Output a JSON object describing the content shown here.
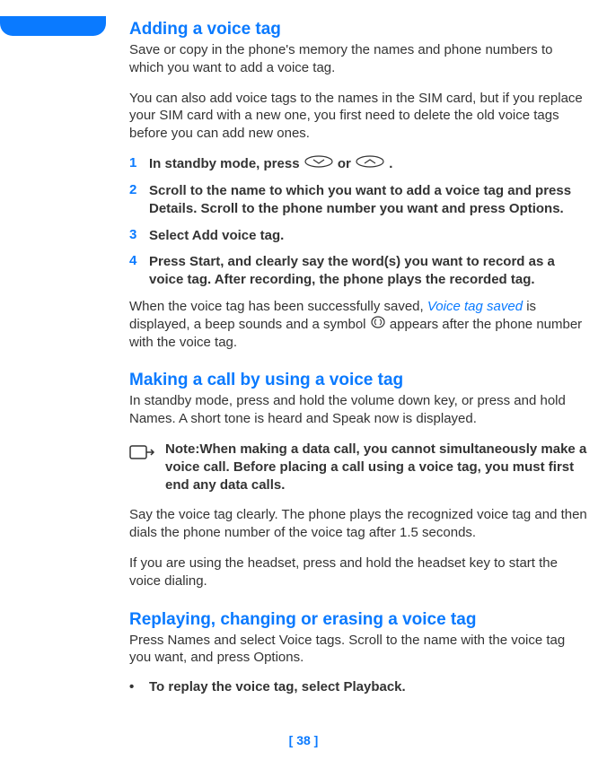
{
  "section1": {
    "title": "Adding a voice tag",
    "p1": "Save or copy in the phone's memory the names and phone numbers to which you want to add a voice tag.",
    "p2": "You can also add voice tags to the names in the SIM card, but if you replace your SIM card with a new one, you first need to delete the old voice tags before you can add new ones.",
    "steps": [
      {
        "num": "1",
        "pre": "In standby mode, press ",
        "mid": " or ",
        "post": "."
      },
      {
        "num": "2",
        "text": "Scroll to the name to which you want to add a voice tag and press Details. Scroll to the phone number you want and press Options."
      },
      {
        "num": "3",
        "text": "Select Add voice tag."
      },
      {
        "num": "4",
        "text": "Press Start, and clearly say the word(s) you want to record as a voice tag. After recording, the phone plays the recorded tag."
      }
    ],
    "p3a": "When the voice tag has been successfully saved, ",
    "p3_em": "Voice tag saved",
    "p3b": " is displayed, a beep sounds and a symbol ",
    "p3c": " appears after the phone number with the voice tag."
  },
  "section2": {
    "title": "Making a call by using a voice tag",
    "p1": "In standby mode, press and hold the volume down key, or press and hold Names. A short tone is heard and Speak now is displayed.",
    "note_label": "Note:",
    "note_text": "When making a data call, you cannot simultaneously make a voice call. Before placing a call using a voice tag, you must first end any data calls.",
    "p2": "Say the voice tag clearly. The phone plays the recognized voice tag and then dials the phone number of the voice tag after 1.5 seconds.",
    "p3": "If you are using the headset, press and hold the headset key to start the voice dialing."
  },
  "section3": {
    "title": "Replaying, changing or erasing a voice tag",
    "p1": "Press Names and select Voice tags. Scroll to the name with the voice tag you want, and press Options.",
    "bullet_dot": "•",
    "bullet1": "To replay the voice tag, select Playback."
  },
  "page_number": "[ 38 ]"
}
